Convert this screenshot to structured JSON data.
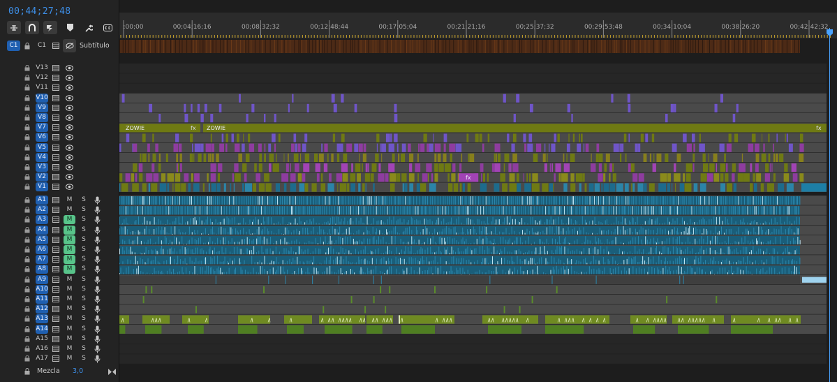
{
  "timecode": "00;44;27;48",
  "toolbar": [
    {
      "name": "snap-nest-icon",
      "glyph": "⊞"
    },
    {
      "name": "magnet-icon",
      "glyph": "∩"
    },
    {
      "name": "linked-selection-icon",
      "glyph": "⧉"
    },
    {
      "name": "marker-icon",
      "glyph": "⬟"
    },
    {
      "name": "wrench-icon",
      "glyph": "🔧"
    },
    {
      "name": "captions-icon",
      "glyph": "CC"
    }
  ],
  "subtitle_track": {
    "target": "C1",
    "label": "C1",
    "name": "Subtítulo"
  },
  "ruler": {
    "labels": [
      ":00;00",
      "00;04;16;16",
      "00;08;32;32",
      "00;12;48;44",
      "00;17;05;04",
      "00;21;21;16",
      "00;25;37;32",
      "00;29;53;48",
      "00;34;10;04",
      "00;38;26;20",
      "00;42;42;32"
    ]
  },
  "video_tracks": [
    {
      "label": "V13",
      "targeted": false
    },
    {
      "label": "V12",
      "targeted": false
    },
    {
      "label": "V11",
      "targeted": false
    },
    {
      "label": "V10",
      "targeted": true
    },
    {
      "label": "V9",
      "targeted": true
    },
    {
      "label": "V8",
      "targeted": true
    },
    {
      "label": "V7",
      "targeted": true
    },
    {
      "label": "V6",
      "targeted": true
    },
    {
      "label": "V5",
      "targeted": true
    },
    {
      "label": "V4",
      "targeted": true
    },
    {
      "label": "V3",
      "targeted": true
    },
    {
      "label": "V2",
      "targeted": true
    },
    {
      "label": "V1",
      "targeted": true
    }
  ],
  "audio_tracks": [
    {
      "label": "A1",
      "targeted": true,
      "mute": false,
      "m": "M",
      "s": "S"
    },
    {
      "label": "A2",
      "targeted": true,
      "mute": false,
      "m": "M",
      "s": "S"
    },
    {
      "label": "A3",
      "targeted": true,
      "mute": true,
      "m": "M",
      "s": "S"
    },
    {
      "label": "A4",
      "targeted": true,
      "mute": true,
      "m": "M",
      "s": "S"
    },
    {
      "label": "A5",
      "targeted": true,
      "mute": true,
      "m": "M",
      "s": "S"
    },
    {
      "label": "A6",
      "targeted": true,
      "mute": true,
      "m": "M",
      "s": "S"
    },
    {
      "label": "A7",
      "targeted": true,
      "mute": true,
      "m": "M",
      "s": "S"
    },
    {
      "label": "A8",
      "targeted": true,
      "mute": true,
      "m": "M",
      "s": "S"
    },
    {
      "label": "A9",
      "targeted": true,
      "mute": false,
      "m": "M",
      "s": "S"
    },
    {
      "label": "A10",
      "targeted": true,
      "mute": false,
      "m": "M",
      "s": "S"
    },
    {
      "label": "A11",
      "targeted": true,
      "mute": false,
      "m": "M",
      "s": "S"
    },
    {
      "label": "A12",
      "targeted": true,
      "mute": false,
      "m": "M",
      "s": "S"
    },
    {
      "label": "A13",
      "targeted": true,
      "mute": false,
      "m": "M",
      "s": "S"
    },
    {
      "label": "A14",
      "targeted": true,
      "mute": false,
      "m": "M",
      "s": "S"
    },
    {
      "label": "A15",
      "targeted": false,
      "mute": false,
      "m": "M",
      "s": "S"
    },
    {
      "label": "A16",
      "targeted": false,
      "mute": false,
      "m": "M",
      "s": "S"
    },
    {
      "label": "A17",
      "targeted": false,
      "mute": false,
      "m": "M",
      "s": "S"
    }
  ],
  "mix": {
    "label": "Mezcla",
    "value": "3,0"
  },
  "clips": {
    "v7_title_1": "ZOWIE",
    "v7_title_2": "ZOWIE",
    "fx": "fx"
  },
  "colors": {
    "accent": "#3d8ee6",
    "target": "#1f5fb0",
    "mute_on": "#58c48a",
    "olive": "#6f7a13",
    "magenta": "#8e3c9f",
    "violet": "#6f55c8",
    "teal": "#1d6b8c",
    "green_audio": "#5a8c2a",
    "subtitle_bar": "#4c2a16"
  }
}
